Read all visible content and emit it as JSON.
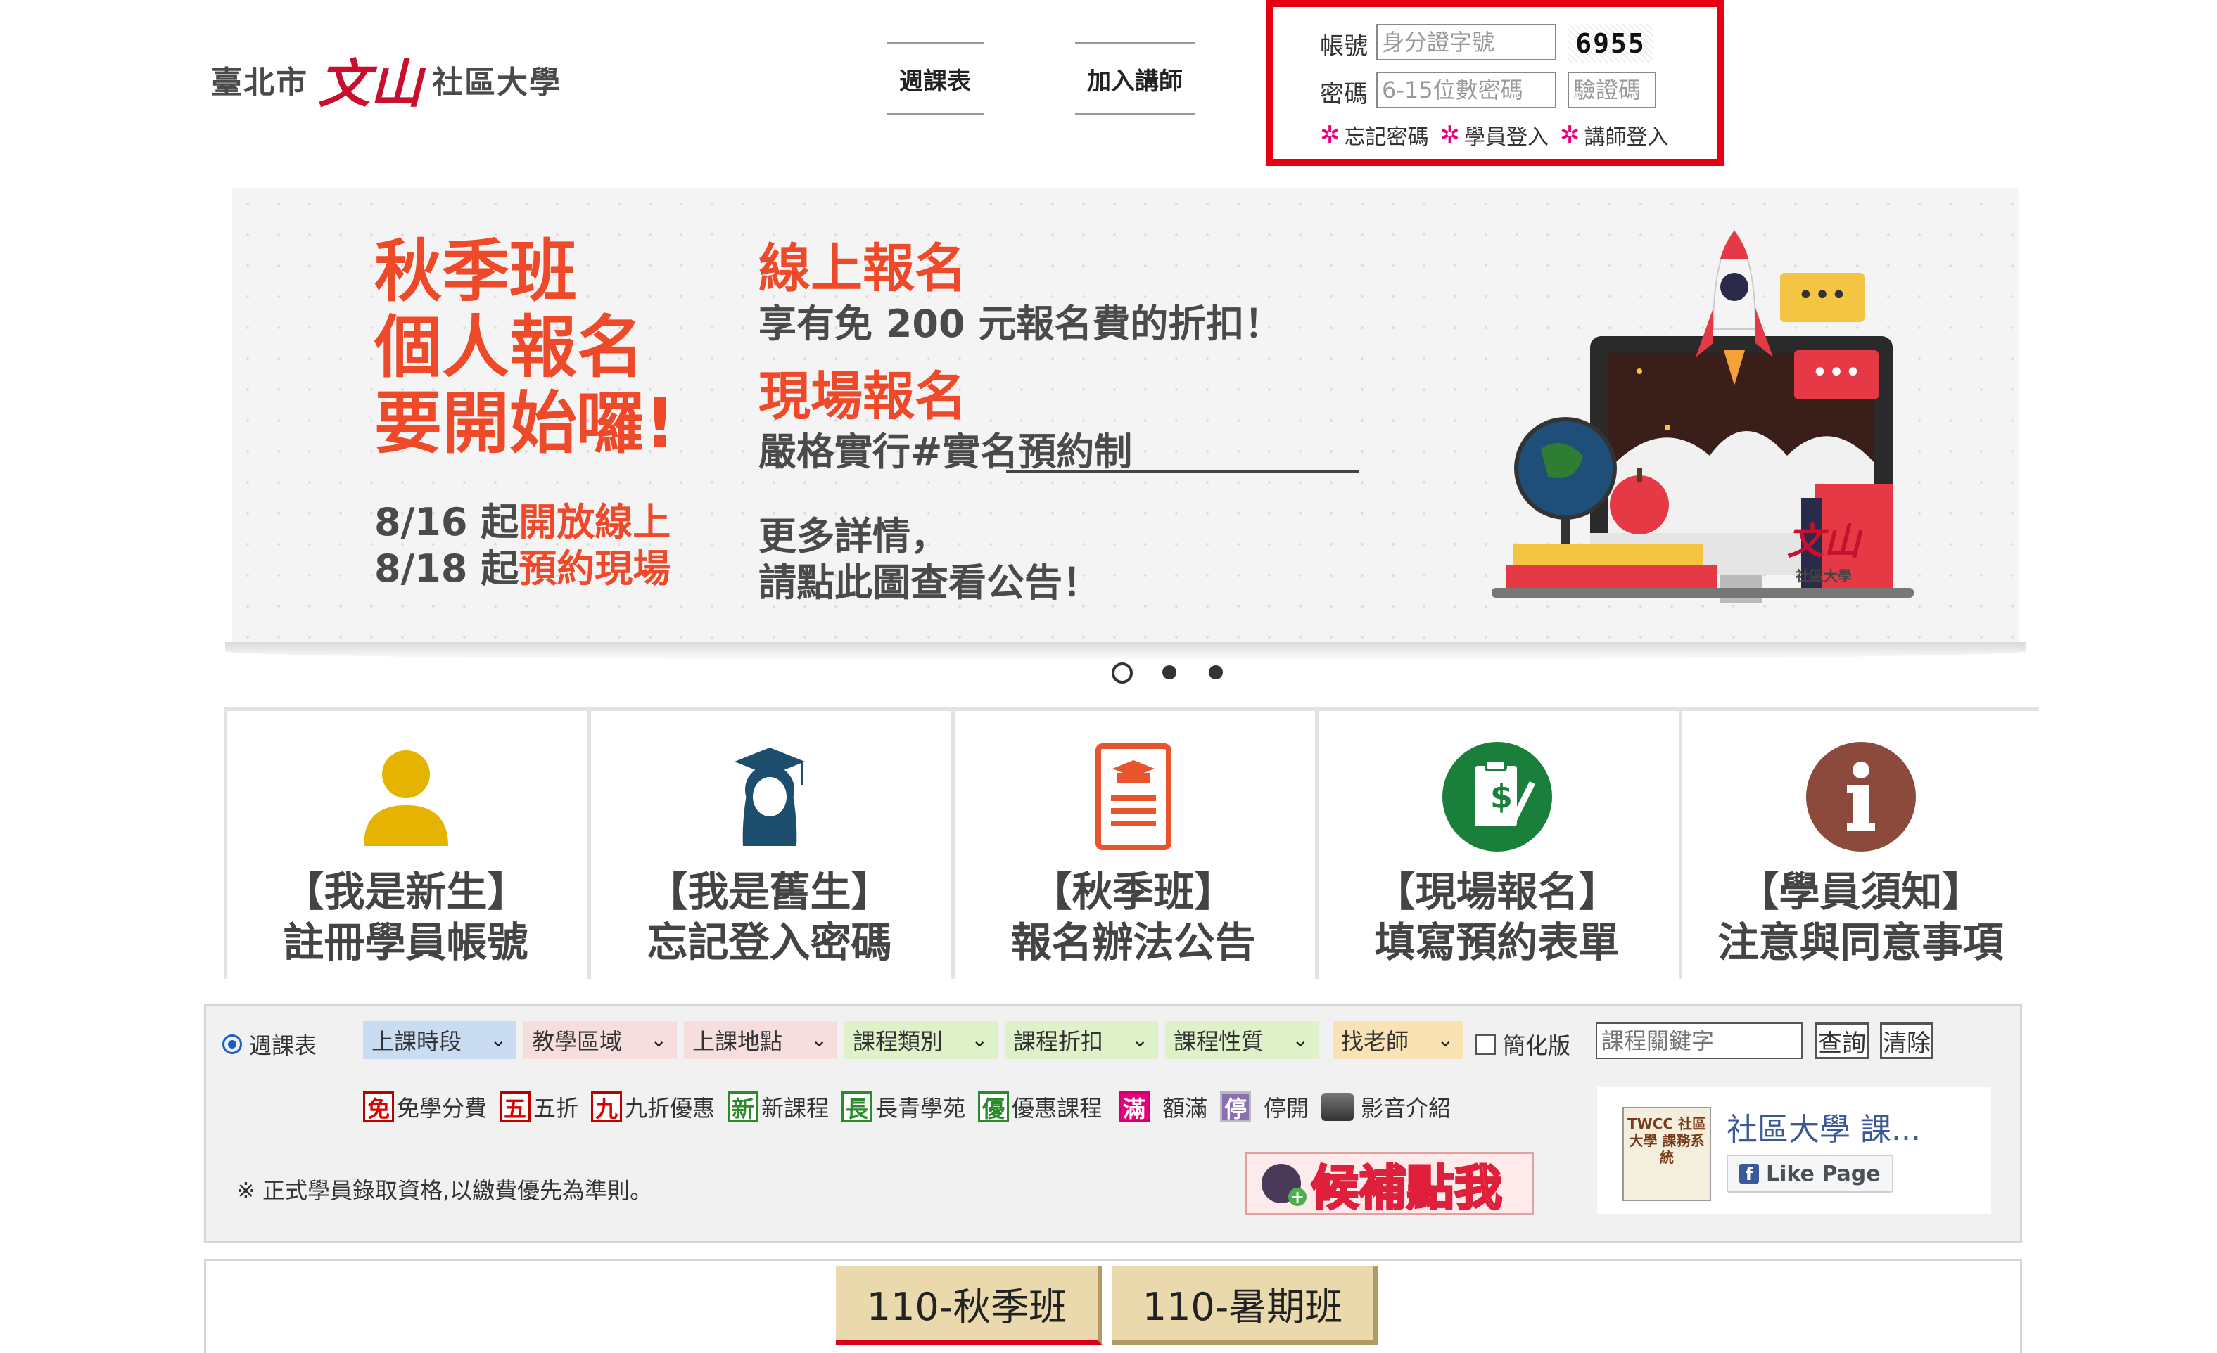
{
  "header": {
    "logo_left": "臺北市",
    "logo_mark": "文山",
    "logo_right": "社區大學",
    "nav": [
      "週課表",
      "加入講師"
    ]
  },
  "login": {
    "account_label": "帳號",
    "account_placeholder": "身分證字號",
    "captcha_image_text": "6955",
    "password_label": "密碼",
    "password_placeholder": "6-15位數密碼",
    "captcha_placeholder": "驗證碼",
    "links": [
      "忘記密碼",
      "學員登入",
      "講師登入"
    ]
  },
  "banner": {
    "headline": [
      "秋季班",
      "個人報名",
      "要開始囉!"
    ],
    "date1_prefix": "8/16 起",
    "date1_highlight": "開放線上",
    "date2_prefix": "8/18 起",
    "date2_highlight": "預約現場",
    "online_title": "線上報名",
    "online_desc": "享有免 200 元報名費的折扣！",
    "onsite_title": "現場報名",
    "onsite_desc": "嚴格實行#實名預約制",
    "more1": "更多詳情，",
    "more2": "請點此圖查看公告！",
    "corner_logo": "社區大學"
  },
  "tiles": [
    {
      "line1": "【我是新生】",
      "line2": "註冊學員帳號",
      "icon": "person-icon",
      "color": "#e6b400"
    },
    {
      "line1": "【我是舊生】",
      "line2": "忘記登入密碼",
      "icon": "graduate-icon",
      "color": "#1d4e6e"
    },
    {
      "line1": "【秋季班】",
      "line2": "報名辦法公告",
      "icon": "document-icon",
      "color": "#e8542c"
    },
    {
      "line1": "【現場報名】",
      "line2": "填寫預約表單",
      "icon": "form-icon",
      "color": "#1a7f3a"
    },
    {
      "line1": "【學員須知】",
      "line2": "注意與同意事項",
      "icon": "info-icon",
      "color": "#8b4a3c"
    }
  ],
  "filter": {
    "radio_label": "週課表",
    "selects": [
      {
        "label": "上課時段",
        "bg": "#c9dcf2"
      },
      {
        "label": "教學區域",
        "bg": "#f6dede"
      },
      {
        "label": "上課地點",
        "bg": "#f6dede"
      },
      {
        "label": "課程類別",
        "bg": "#dff1c9"
      },
      {
        "label": "課程折扣",
        "bg": "#dff1c9"
      },
      {
        "label": "課程性質",
        "bg": "#dff1c9"
      },
      {
        "label": "找老師",
        "bg": "#f9e3b5"
      }
    ],
    "simple_label": "簡化版",
    "keyword_placeholder": "課程關鍵字",
    "search_btn": "查詢",
    "clear_btn": "清除",
    "legend": [
      {
        "mark": "免",
        "text": "免學分費"
      },
      {
        "mark": "五",
        "text": "五折"
      },
      {
        "mark": "九",
        "text": "九折優惠"
      },
      {
        "mark": "新",
        "text": "新課程"
      },
      {
        "mark": "長",
        "text": "長青學苑"
      },
      {
        "mark": "優",
        "text": "優惠課程"
      },
      {
        "mark": "滿",
        "text": "額滿"
      },
      {
        "mark": "停",
        "text": "停開"
      },
      {
        "mark": "",
        "text": "影音介紹"
      }
    ],
    "note": "※ 正式學員錄取資格,以繳費優先為準則。",
    "waitlist_btn": "候補點我"
  },
  "facebook": {
    "page_name": "社區大學 課...",
    "like_label": "Like Page",
    "thumb_text": "TWCC 社區大學 課務系統"
  },
  "tabs": [
    "110-秋季班",
    "110-暑期班"
  ]
}
